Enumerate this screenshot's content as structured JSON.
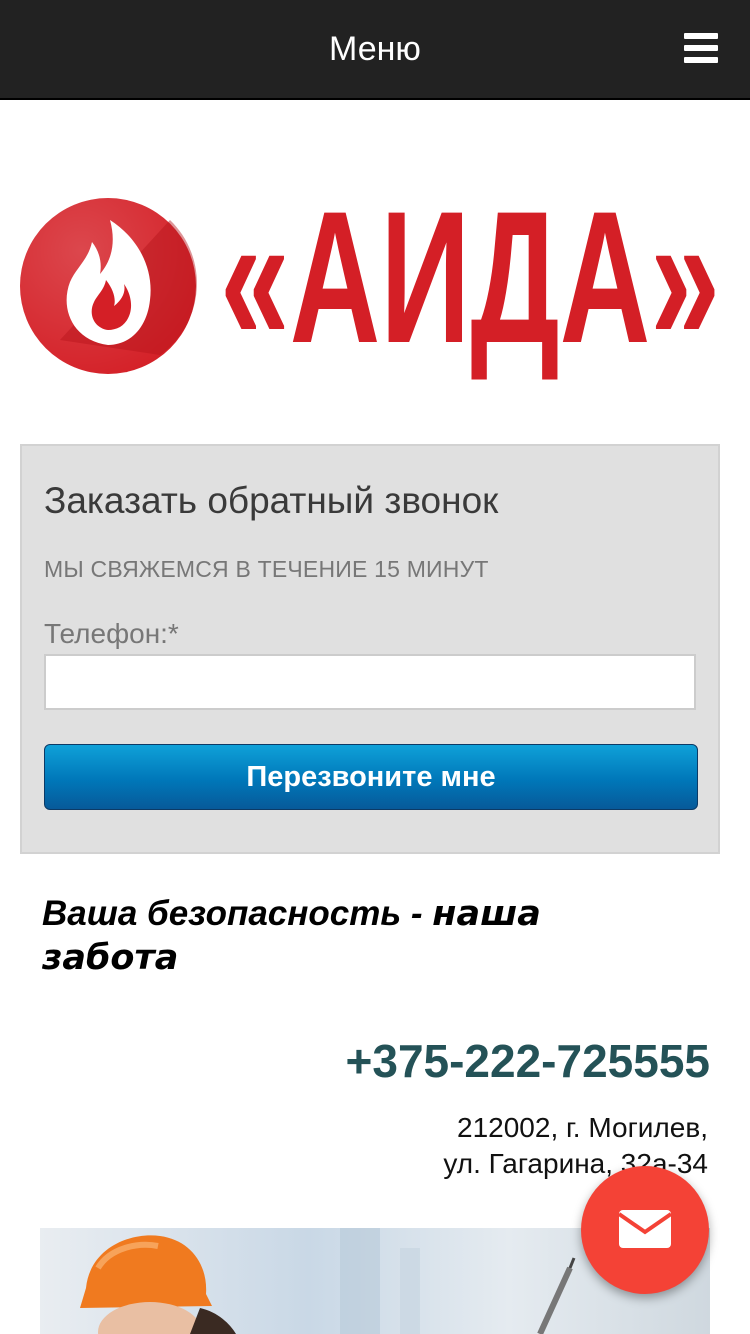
{
  "header": {
    "menu_label": "Меню",
    "menu_icon": "hamburger-icon"
  },
  "logo": {
    "text": "«АИДА»",
    "brand_color": "#d41f26",
    "icon": "flame-icon"
  },
  "callback_form": {
    "heading": "Заказать обратный звонок",
    "subheading": "МЫ СВЯЖЕМСЯ В ТЕЧЕНИЕ 15 МИНУТ",
    "phone_label": "Телефон:*",
    "phone_value": "",
    "submit_label": "Перезвоните мне",
    "button_color": "#0a8bc7"
  },
  "slogan": {
    "part1": "Ваша безопасность - ",
    "part2": "наша забота"
  },
  "contact": {
    "phone": "+375-222-725555",
    "address_line1": "212002, г. Могилев,",
    "address_line2": "ул. Гагарина, 32а-34"
  },
  "fab": {
    "icon": "mail-icon",
    "color": "#f44236"
  }
}
